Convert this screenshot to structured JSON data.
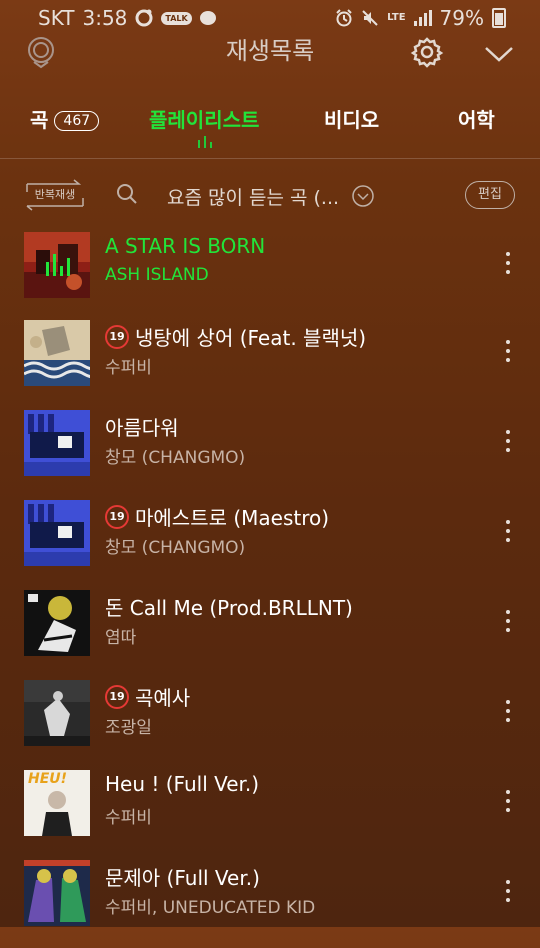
{
  "status_bar": {
    "carrier": "SKT",
    "time": "3:58",
    "talk_badge": "TALK",
    "network": "LTE",
    "battery": "79%"
  },
  "header": {
    "title": "재생목록"
  },
  "tabs": [
    {
      "label": "곡",
      "count": "467"
    },
    {
      "label": "플레이리스트"
    },
    {
      "label": "비디오"
    },
    {
      "label": "어학"
    }
  ],
  "toolbar": {
    "repeat_label": "반복재생",
    "filter_text": "요즘 많이 듣는 곡 (...",
    "edit_label": "편집"
  },
  "songs": [
    {
      "title": "A STAR IS BORN",
      "artist": "ASH ISLAND",
      "playing": true,
      "explicit": false
    },
    {
      "title": "냉탕에 상어 (Feat. 블랙넛)",
      "artist": "수퍼비",
      "explicit": true
    },
    {
      "title": "아름다워",
      "artist": "창모 (CHANGMO)",
      "explicit": false
    },
    {
      "title": "마에스트로 (Maestro)",
      "artist": "창모 (CHANGMO)",
      "explicit": true
    },
    {
      "title": "돈 Call Me (Prod.BRLLNT)",
      "artist": "염따",
      "explicit": false
    },
    {
      "title": "곡예사",
      "artist": "조광일",
      "explicit": true
    },
    {
      "title": "Heu ! (Full Ver.)",
      "artist": "수퍼비",
      "explicit": false
    },
    {
      "title": "문제아 (Full Ver.)",
      "artist": "수퍼비, UNEDUCATED KID",
      "explicit": false
    }
  ],
  "explicit_badge": "19",
  "cover_text_heu": "HEU!",
  "colors": {
    "accent_green": "#22e43a",
    "explicit_red": "#e53935"
  }
}
